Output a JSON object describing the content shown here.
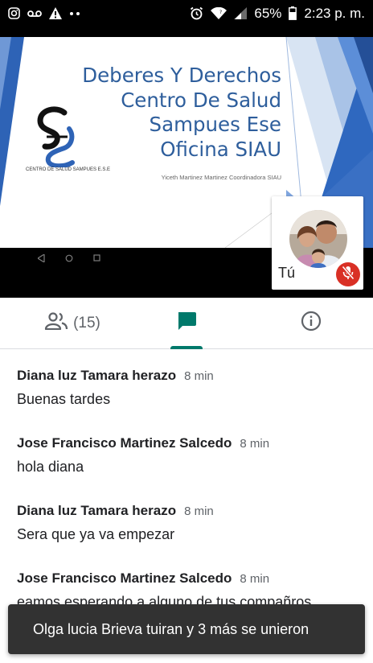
{
  "status_bar": {
    "battery": "65%",
    "time": "2:23 p. m.",
    "icons_left": [
      "instagram-icon",
      "voicemail-icon",
      "warning-icon",
      "more-dots-icon"
    ],
    "icons_right": [
      "alarm-icon",
      "wifi-icon",
      "signal-icon",
      "battery-icon"
    ]
  },
  "presentation": {
    "title_lines": [
      "Deberes Y Derechos",
      "Centro De Salud",
      "Sampues Ese",
      "Oficina SIAU"
    ],
    "subtitle": "Yiceth  Martinez Martinez Coordinadora SIAU",
    "logo_caption": "CENTRO DE SALUD SAMPUES E.S.E",
    "accent_color": "#2e5e9c"
  },
  "self_view": {
    "label": "Tú",
    "mic_state": "muted"
  },
  "tabs": {
    "people_count": "(15)",
    "active": "chat",
    "accent_color": "#00796b"
  },
  "chat": {
    "messages": [
      {
        "sender": "Diana luz Tamara herazo",
        "time": "8 min",
        "text": "Buenas tardes"
      },
      {
        "sender": "Jose Francisco Martinez Salcedo",
        "time": "8 min",
        "text": "hola diana"
      },
      {
        "sender": "Diana luz Tamara herazo",
        "time": "8 min",
        "text": "Sera que ya va empezar"
      },
      {
        "sender": "Jose Francisco Martinez Salcedo",
        "time": "8 min",
        "text": "eamos esperando a alguno de tus compañros"
      }
    ]
  },
  "toast": {
    "text": "Olga lucia Brieva tuiran y 3 más se unieron"
  }
}
